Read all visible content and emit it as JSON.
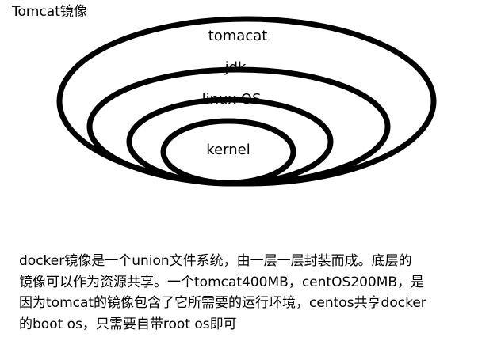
{
  "title": "Tomcat镜像",
  "layers": [
    {
      "label": "tomacat"
    },
    {
      "label": "jdk"
    },
    {
      "label": "linux OS"
    },
    {
      "label": "kernel"
    }
  ],
  "colors": {
    "stroke": "#000000",
    "background": "#ffffff"
  },
  "caption": {
    "lines": [
      "docker镜像是一个union文件系统，由一层一层封装而成。底层的",
      "镜像可以作为资源共享。一个tomcat400MB，centOS200MB，是",
      "因为tomcat的镜像包含了它所需要的运行环境，centos共享docker",
      "的boot os，只需要自带root os即可"
    ]
  }
}
